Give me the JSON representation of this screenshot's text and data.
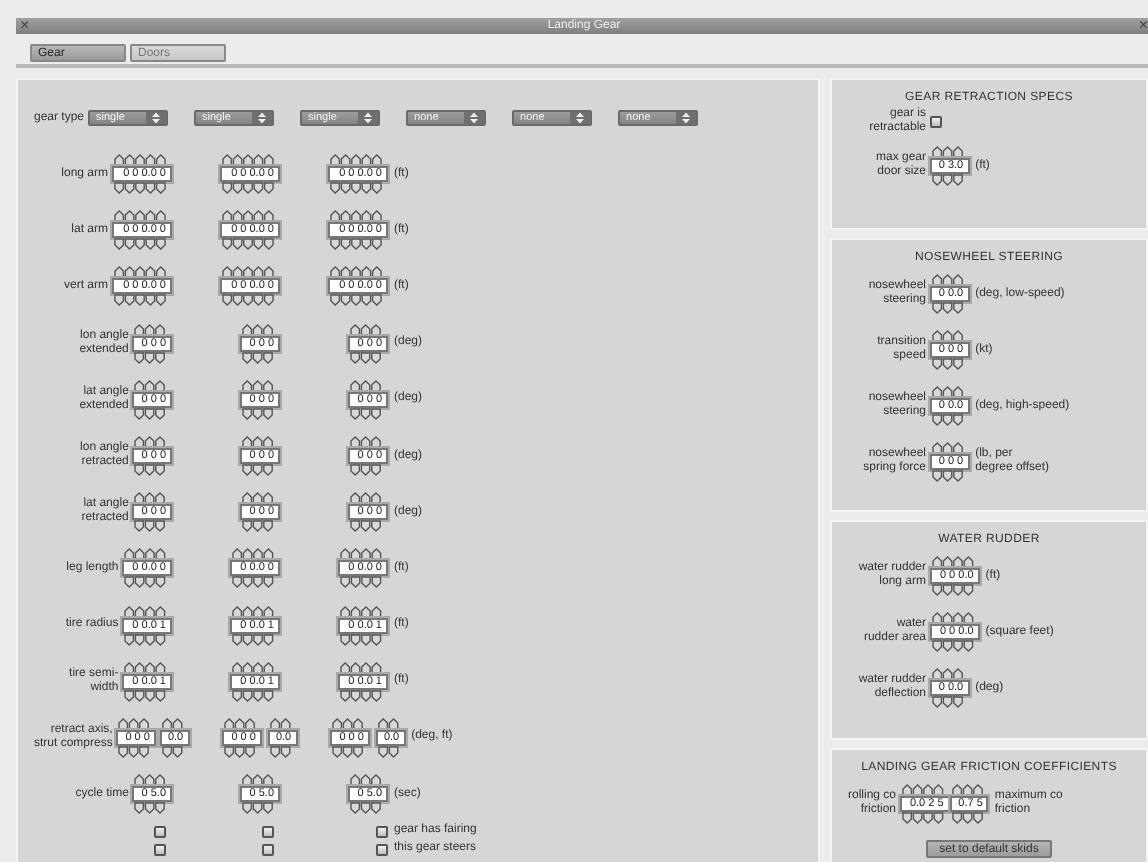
{
  "window": {
    "title": "Landing Gear",
    "close_glyph": "×"
  },
  "tabs": [
    {
      "label": "Gear",
      "selected": true
    },
    {
      "label": "Doors",
      "selected": false
    }
  ],
  "gear_type": {
    "label": "gear type",
    "options": [
      "single",
      "single",
      "single",
      "none",
      "none",
      "none"
    ]
  },
  "gear_rows": [
    {
      "label": "long arm",
      "columns": [
        [
          "0 0 0.0 0"
        ],
        [
          "0 0 0.0 0"
        ],
        [
          "0 0 0.0 0"
        ]
      ],
      "unit": "(ft)"
    },
    {
      "label": "lat arm",
      "columns": [
        [
          "0 0 0.0 0"
        ],
        [
          "0 0 0.0 0"
        ],
        [
          "0 0 0.0 0"
        ]
      ],
      "unit": "(ft)"
    },
    {
      "label": "vert arm",
      "columns": [
        [
          "0 0 0.0 0"
        ],
        [
          "0 0 0.0 0"
        ],
        [
          "0 0 0.0 0"
        ]
      ],
      "unit": "(ft)"
    },
    {
      "label": "lon angle\nextended",
      "columns": [
        [
          "0 0 0"
        ],
        [
          "0 0 0"
        ],
        [
          "0 0 0"
        ]
      ],
      "unit": "(deg)"
    },
    {
      "label": "lat angle\nextended",
      "columns": [
        [
          "0 0 0"
        ],
        [
          "0 0 0"
        ],
        [
          "0 0 0"
        ]
      ],
      "unit": "(deg)"
    },
    {
      "label": "lon angle\nretracted",
      "columns": [
        [
          "0 0 0"
        ],
        [
          "0 0 0"
        ],
        [
          "0 0 0"
        ]
      ],
      "unit": "(deg)"
    },
    {
      "label": "lat angle\nretracted",
      "columns": [
        [
          "0 0 0"
        ],
        [
          "0 0 0"
        ],
        [
          "0 0 0"
        ]
      ],
      "unit": "(deg)"
    },
    {
      "label": "leg length",
      "columns": [
        [
          "0 0.0 0"
        ],
        [
          "0 0.0 0"
        ],
        [
          "0 0.0 0"
        ]
      ],
      "unit": "(ft)"
    },
    {
      "label": "tire radius",
      "columns": [
        [
          "0 0.0 1"
        ],
        [
          "0 0.0 1"
        ],
        [
          "0 0.0 1"
        ]
      ],
      "unit": "(ft)"
    },
    {
      "label": "tire semi-\nwidth",
      "columns": [
        [
          "0 0.0 1"
        ],
        [
          "0 0.0 1"
        ],
        [
          "0 0.0 1"
        ]
      ],
      "unit": "(ft)"
    },
    {
      "label": "retract axis,\nstrut compress",
      "columns": [
        [
          "0 0 0",
          "0.0"
        ],
        [
          "0 0 0",
          "0.0"
        ],
        [
          "0 0 0",
          "0.0"
        ]
      ],
      "unit": "(deg, ft)"
    },
    {
      "label": "cycle time",
      "columns": [
        [
          "0 5.0"
        ],
        [
          "0 5.0"
        ],
        [
          "0 5.0"
        ]
      ],
      "unit": "(sec)"
    }
  ],
  "option_rows": [
    {
      "label": "gear has fairing",
      "checked": [
        false,
        false,
        false
      ]
    },
    {
      "label": "this gear steers",
      "checked": [
        false,
        false,
        false
      ]
    }
  ],
  "sections": [
    {
      "title": "GEAR RETRACTION SPECS",
      "rows": [
        {
          "kind": "checkbox",
          "label": "gear is\nretractable",
          "checked": false
        },
        {
          "kind": "field",
          "label": "max gear\ndoor size",
          "value": "0 3.0",
          "unit": "(ft)"
        }
      ]
    },
    {
      "title": "NOSEWHEEL STEERING",
      "rows": [
        {
          "kind": "field",
          "label": "nosewheel\nsteering",
          "value": "0 0.0",
          "unit": "(deg, low-speed)"
        },
        {
          "kind": "field",
          "label": "transition\nspeed",
          "value": "0 0 0",
          "unit": "(kt)"
        },
        {
          "kind": "field",
          "label": "nosewheel\nsteering",
          "value": "0 0.0",
          "unit": "(deg, high-speed)"
        },
        {
          "kind": "field",
          "label": "nosewheel\nspring force",
          "value": "0 0 0",
          "unit": "(lb, per\ndegree offset)"
        }
      ]
    },
    {
      "title": "WATER RUDDER",
      "rows": [
        {
          "kind": "field",
          "label": "water rudder\nlong arm",
          "value": "0 0 0.0",
          "unit": "(ft)"
        },
        {
          "kind": "field",
          "label": "water\nrudder area",
          "value": "0 0 0.0",
          "unit": "(square feet)"
        },
        {
          "kind": "field",
          "label": "water rudder\ndeflection",
          "value": "0 0.0",
          "unit": "(deg)"
        }
      ]
    },
    {
      "title": "LANDING GEAR FRICTION COEFFICIENTS",
      "rows": [
        {
          "kind": "pair",
          "label": "rolling co\nfriction",
          "values": [
            "0.0 2 5",
            "0.7 5"
          ],
          "unit": "maximum co\nfriction"
        },
        {
          "kind": "button",
          "label": "set to default skids"
        }
      ]
    }
  ]
}
